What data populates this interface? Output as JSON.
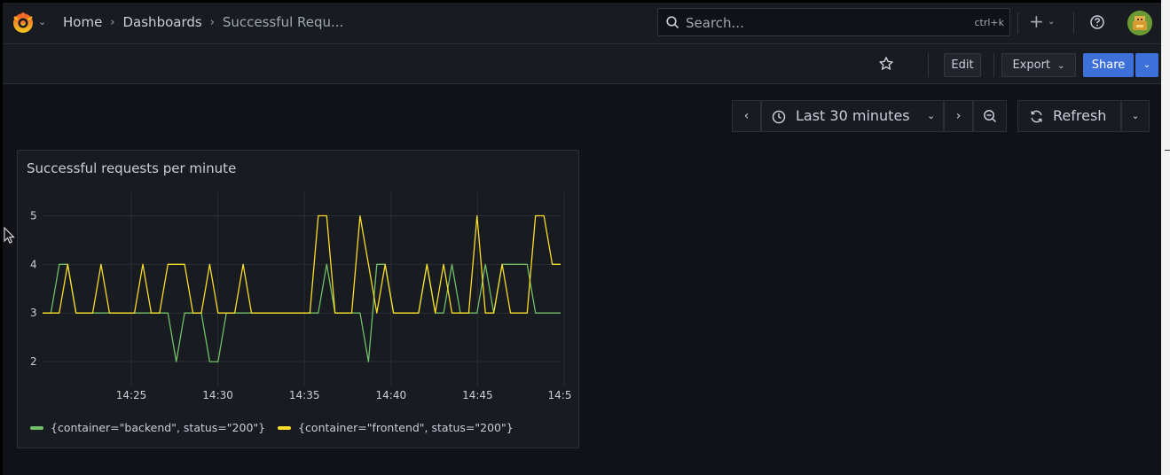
{
  "topnav": {
    "breadcrumb": [
      "Home",
      "Dashboards",
      "Successful Requ..."
    ],
    "search_placeholder": "Search...",
    "search_shortcut": "ctrl+k"
  },
  "toolbar": {
    "edit_label": "Edit",
    "export_label": "Export",
    "share_label": "Share"
  },
  "timepicker": {
    "range_label": "Last 30 minutes",
    "refresh_label": "Refresh"
  },
  "panel": {
    "title": "Successful requests per minute"
  },
  "colors": {
    "backend": "#73bf69",
    "frontend": "#fade2a",
    "accent": "#3d71d9"
  },
  "chart_data": {
    "type": "line",
    "x": [
      "14:21",
      "14:22",
      "14:23",
      "14:24",
      "14:25",
      "14:26",
      "14:27",
      "14:28",
      "14:29",
      "14:30",
      "14:31",
      "14:32",
      "14:33",
      "14:34",
      "14:35",
      "14:36",
      "14:37",
      "14:38",
      "14:39",
      "14:40",
      "14:41",
      "14:42",
      "14:43",
      "14:44",
      "14:45",
      "14:46",
      "14:47",
      "14:48",
      "14:49",
      "14:50"
    ],
    "xtick_labels": [
      "14:25",
      "14:30",
      "14:35",
      "14:40",
      "14:45",
      "14:5"
    ],
    "ytick_labels": [
      "2",
      "3",
      "4",
      "5"
    ],
    "ylim": [
      1.6,
      5.3
    ],
    "series": [
      {
        "name": "{container=\"backend\", status=\"200\"}",
        "values": [
          3,
          3,
          4,
          4,
          3,
          3,
          3,
          3,
          3,
          3,
          3,
          3,
          3,
          3,
          3,
          3,
          2,
          3,
          3,
          3,
          2,
          2,
          3,
          3,
          3,
          3,
          3,
          3,
          3,
          3,
          3,
          3,
          3,
          3,
          4,
          3,
          3,
          3,
          3,
          2,
          4,
          4,
          3,
          3,
          3,
          3,
          4,
          3,
          3,
          4,
          3,
          3,
          3,
          4,
          3,
          4,
          4,
          4,
          4,
          3,
          3,
          3,
          3
        ]
      },
      {
        "name": "{container=\"frontend\", status=\"200\"}",
        "values": [
          3,
          3,
          3,
          4,
          3,
          3,
          3,
          4,
          3,
          3,
          3,
          3,
          4,
          3,
          3,
          4,
          4,
          4,
          3,
          3,
          4,
          3,
          3,
          3,
          4,
          3,
          3,
          3,
          3,
          3,
          3,
          3,
          3,
          5,
          5,
          3,
          3,
          3,
          5,
          4,
          3,
          4,
          3,
          3,
          3,
          3,
          4,
          3,
          4,
          3,
          3,
          3,
          5,
          3,
          3,
          4,
          3,
          3,
          3,
          5,
          5,
          4,
          4
        ]
      }
    ]
  }
}
